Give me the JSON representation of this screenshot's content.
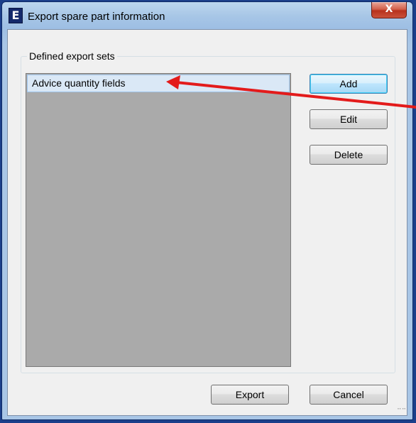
{
  "window": {
    "title": "Export spare part information",
    "app_icon_glyph": "E",
    "close_glyph": "X"
  },
  "group": {
    "label": "Defined export sets",
    "items": [
      "Advice quantity fields"
    ],
    "selected_index": 0
  },
  "buttons": {
    "add": "Add",
    "edit": "Edit",
    "delete": "Delete",
    "export": "Export",
    "cancel": "Cancel"
  },
  "colors": {
    "annotation_arrow": "#e31b1b",
    "list_background": "#aaaaaa",
    "selection": "#dae8f6"
  }
}
